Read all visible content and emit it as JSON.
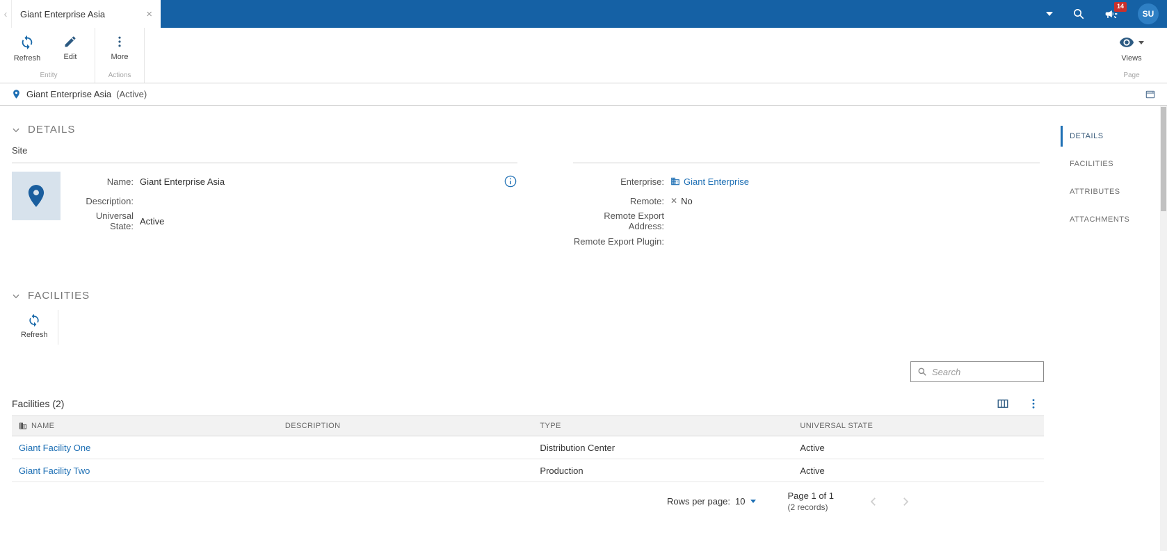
{
  "topbar": {
    "tab_title": "Giant Enterprise Asia",
    "notification_badge": "14",
    "avatar_initials": "SU"
  },
  "ribbon": {
    "refresh_label": "Refresh",
    "edit_label": "Edit",
    "more_label": "More",
    "entity_group_label": "Entity",
    "actions_group_label": "Actions",
    "views_label": "Views",
    "page_group_label": "Page"
  },
  "titlebar": {
    "title": "Giant Enterprise Asia",
    "state": "(Active)"
  },
  "details": {
    "header": "DETAILS",
    "subheader": "Site",
    "name_label": "Name:",
    "name_value": "Giant Enterprise Asia",
    "description_label": "Description:",
    "description_value": "",
    "universal_state_label": "Universal State:",
    "universal_state_value": "Active",
    "enterprise_label": "Enterprise:",
    "enterprise_value": "Giant Enterprise",
    "remote_label": "Remote:",
    "remote_value": "No",
    "remote_export_address_label": "Remote Export Address:",
    "remote_export_address_value": "",
    "remote_export_plugin_label": "Remote Export Plugin:",
    "remote_export_plugin_value": ""
  },
  "facilities": {
    "header": "FACILITIES",
    "refresh_label": "Refresh",
    "search_placeholder": "Search",
    "table_title": "Facilities (2)",
    "columns": [
      "NAME",
      "DESCRIPTION",
      "TYPE",
      "UNIVERSAL STATE"
    ],
    "rows": [
      {
        "name": "Giant Facility One",
        "description": "",
        "type": "Distribution Center",
        "state": "Active"
      },
      {
        "name": "Giant Facility Two",
        "description": "",
        "type": "Production",
        "state": "Active"
      }
    ],
    "rows_per_page_label": "Rows per page:",
    "rows_per_page_value": "10",
    "page_info": "Page 1 of 1",
    "records_info": "(2 records)"
  },
  "sidenav": {
    "items": [
      {
        "label": "DETAILS"
      },
      {
        "label": "FACILITIES"
      },
      {
        "label": "ATTRIBUTES"
      },
      {
        "label": "ATTACHMENTS"
      }
    ]
  },
  "colors": {
    "topbar_blue": "#1561A5",
    "link_blue": "#1D6FB4",
    "badge_red": "#C9302C",
    "pin_box_bg": "#D7E2EC"
  }
}
